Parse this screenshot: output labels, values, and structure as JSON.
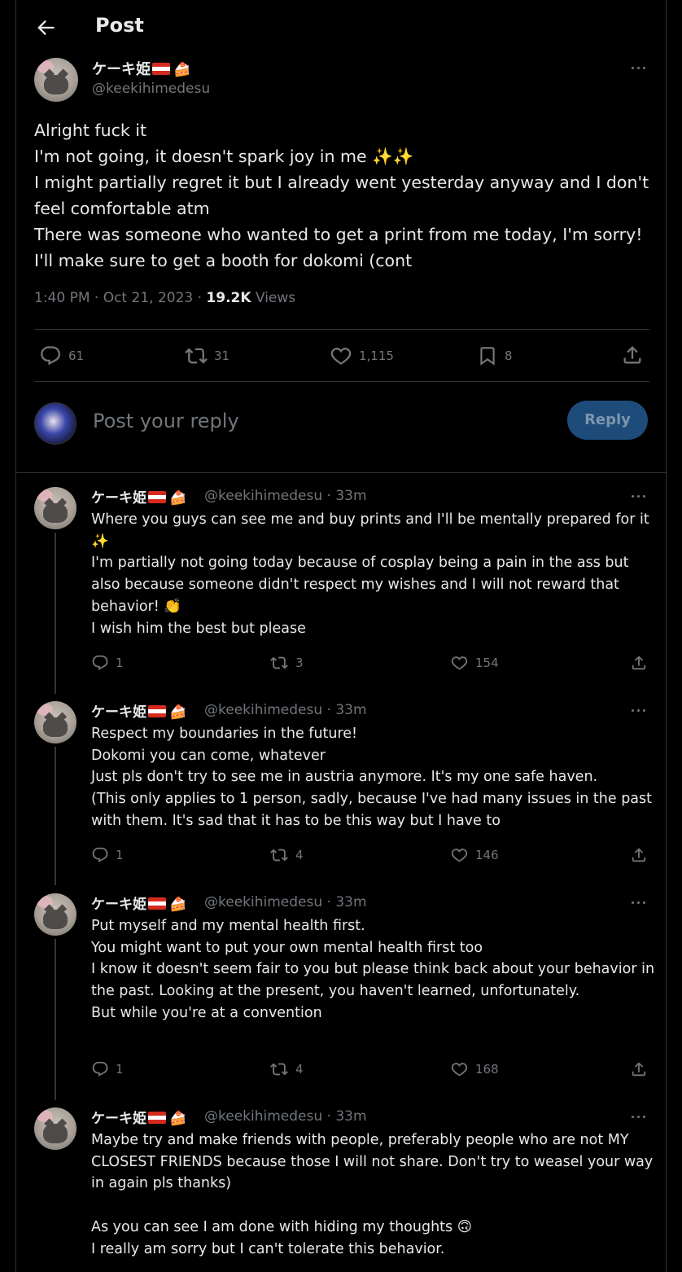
{
  "header": {
    "title": "Post"
  },
  "main_post": {
    "name": "ケーキ姫",
    "handle": "@keekihimedesu",
    "text": "Alright fuck it\nI'm not going, it doesn't spark joy in me ✨✨\nI might partially regret it but I already went yesterday anyway and I don't feel comfortable atm\nThere was someone who wanted to get a print from me today, I'm sorry!\nI'll make sure to get a booth for dokomi (cont",
    "time": "1:40 PM · Oct 21, 2023 · ",
    "views_count": "19.2K",
    "views_label": " Views",
    "stats": {
      "replies": "61",
      "reposts": "31",
      "likes": "1,115",
      "bookmarks": "8"
    }
  },
  "reply_box": {
    "placeholder": "Post your reply",
    "button": "Reply"
  },
  "replies": [
    {
      "name": "ケーキ姫",
      "handle": "@keekihimedesu · 33m",
      "text": "Where you guys can see me and buy prints and I'll be mentally prepared for it ✨\nI'm partially not going today because of cosplay being a pain in the ass but also because someone didn't respect my wishes and I will not reward that behavior! 👏\nI wish him the best but please",
      "replies": "1",
      "reposts": "3",
      "likes": "154"
    },
    {
      "name": "ケーキ姫",
      "handle": "@keekihimedesu · 33m",
      "text": "Respect my boundaries in the future!\nDokomi you can come, whatever\nJust pls don't try to see me in austria anymore. It's my one safe haven.\n(This only applies to 1 person, sadly, because I've had many issues in the past with them. It's sad that it has to be this way but I have to",
      "replies": "1",
      "reposts": "4",
      "likes": "146"
    },
    {
      "name": "ケーキ姫",
      "handle": "@keekihimedesu · 33m",
      "text": "Put myself and my mental health first.\nYou might want to put your own mental health first too\nI know it doesn't seem fair to you but please think back about your behavior in the past. Looking at the present, you haven't learned, unfortunately.\nBut while you're at a convention",
      "replies": "1",
      "reposts": "4",
      "likes": "168"
    },
    {
      "name": "ケーキ姫",
      "handle": "@keekihimedesu · 33m",
      "text": "Maybe try and make friends with people, preferably people who are not MY CLOSEST FRIENDS because those I will not share. Don't try to weasel your way in again pls thanks)\n\nAs you can see I am done with hiding my thoughts 🙃\nI really am sorry but I can't tolerate this behavior."
    }
  ],
  "icons": {
    "back": "arrow-left-icon",
    "reply": "speech-bubble-icon",
    "repost": "repost-arrows-icon",
    "like": "heart-icon",
    "bookmark": "bookmark-icon",
    "share": "share-upload-icon",
    "more": "more-dots-icon"
  },
  "colors": {
    "background": "#000000",
    "text": "#e7e9ea",
    "muted": "#71767b",
    "border": "#2f3336",
    "reply_button": "#1d4c7b"
  }
}
